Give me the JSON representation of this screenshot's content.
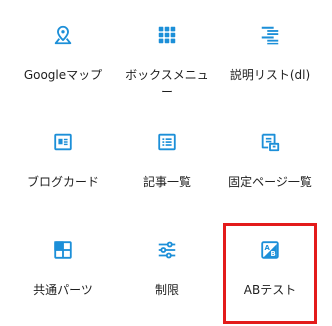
{
  "blocks": [
    {
      "label": "Googleマップ",
      "icon": "map-pin-icon"
    },
    {
      "label": "ボックスメニュー",
      "icon": "grid-menu-icon"
    },
    {
      "label": "説明リスト(dl)",
      "icon": "description-list-icon"
    },
    {
      "label": "ブログカード",
      "icon": "blog-card-icon"
    },
    {
      "label": "記事一覧",
      "icon": "post-list-icon"
    },
    {
      "label": "固定ページ一覧",
      "icon": "page-list-icon"
    },
    {
      "label": "共通パーツ",
      "icon": "common-parts-icon"
    },
    {
      "label": "制限",
      "icon": "restriction-icon"
    },
    {
      "label": "ABテスト",
      "icon": "ab-test-icon"
    }
  ],
  "colors": {
    "icon": "#1c8fd8",
    "label": "#1e1e1e",
    "highlight": "#e31b1b"
  }
}
